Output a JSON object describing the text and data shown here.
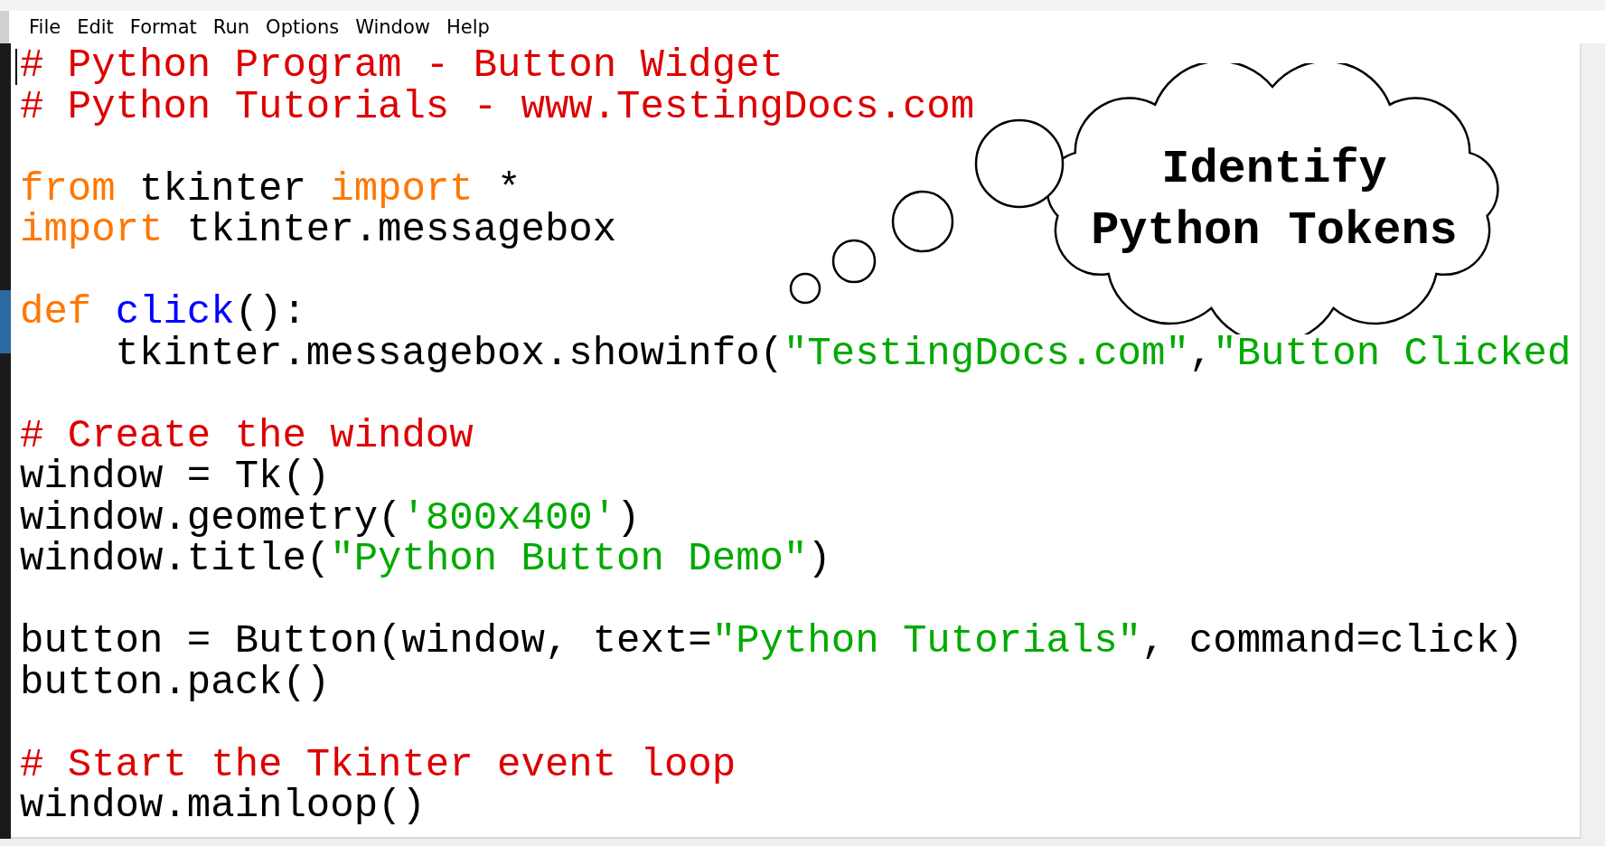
{
  "menu": [
    "File",
    "Edit",
    "Format",
    "Run",
    "Options",
    "Window",
    "Help"
  ],
  "code_lines": [
    {
      "kind": "code",
      "tokens": [
        {
          "kind": "comment",
          "text": "# Python Program - Button Widget"
        }
      ]
    },
    {
      "kind": "code",
      "tokens": [
        {
          "kind": "comment",
          "text": "# Python Tutorials - www.TestingDocs.com"
        }
      ]
    },
    {
      "kind": "blank"
    },
    {
      "kind": "code",
      "tokens": [
        {
          "kind": "keyword",
          "text": "from"
        },
        {
          "kind": "plain",
          "text": " tkinter "
        },
        {
          "kind": "keyword",
          "text": "import"
        },
        {
          "kind": "plain",
          "text": " *"
        }
      ]
    },
    {
      "kind": "code",
      "tokens": [
        {
          "kind": "keyword",
          "text": "import"
        },
        {
          "kind": "plain",
          "text": " tkinter.messagebox"
        }
      ]
    },
    {
      "kind": "blank"
    },
    {
      "kind": "code",
      "tokens": [
        {
          "kind": "keyword",
          "text": "def "
        },
        {
          "kind": "definition",
          "text": "click"
        },
        {
          "kind": "plain",
          "text": "():"
        }
      ]
    },
    {
      "kind": "code",
      "tokens": [
        {
          "kind": "plain",
          "text": "    tkinter.messagebox.showinfo("
        },
        {
          "kind": "string",
          "text": "\"TestingDocs.com\""
        },
        {
          "kind": "plain",
          "text": ","
        },
        {
          "kind": "string",
          "text": "\"Button Clicked"
        }
      ]
    },
    {
      "kind": "blank"
    },
    {
      "kind": "code",
      "tokens": [
        {
          "kind": "comment",
          "text": "# Create the window"
        }
      ]
    },
    {
      "kind": "code",
      "tokens": [
        {
          "kind": "plain",
          "text": "window = Tk()"
        }
      ]
    },
    {
      "kind": "code",
      "tokens": [
        {
          "kind": "plain",
          "text": "window.geometry("
        },
        {
          "kind": "string",
          "text": "'800x400'"
        },
        {
          "kind": "plain",
          "text": ")"
        }
      ]
    },
    {
      "kind": "code",
      "tokens": [
        {
          "kind": "plain",
          "text": "window.title("
        },
        {
          "kind": "string",
          "text": "\"Python Button Demo\""
        },
        {
          "kind": "plain",
          "text": ")"
        }
      ]
    },
    {
      "kind": "blank"
    },
    {
      "kind": "code",
      "tokens": [
        {
          "kind": "plain",
          "text": "button = Button(window, text="
        },
        {
          "kind": "string",
          "text": "\"Python Tutorials\""
        },
        {
          "kind": "plain",
          "text": ", command=click)"
        }
      ]
    },
    {
      "kind": "code",
      "tokens": [
        {
          "kind": "plain",
          "text": "button.pack()"
        }
      ]
    },
    {
      "kind": "blank"
    },
    {
      "kind": "code",
      "tokens": [
        {
          "kind": "comment",
          "text": "# Start the Tkinter event loop"
        }
      ]
    },
    {
      "kind": "code",
      "tokens": [
        {
          "kind": "plain",
          "text": "window.mainloop()"
        }
      ]
    }
  ],
  "thought_bubble": {
    "lines": [
      "Identify",
      "Python Tokens"
    ]
  }
}
